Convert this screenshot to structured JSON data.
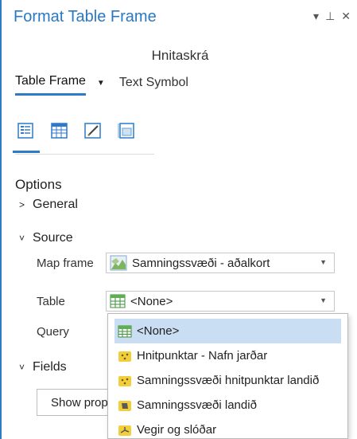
{
  "header": {
    "title": "Format Table Frame",
    "controls": [
      "▾",
      "⊥",
      "✕"
    ]
  },
  "layer_name": "Hnitaskrá",
  "tabs": {
    "table_frame": "Table Frame",
    "text_symbol": "Text Symbol"
  },
  "icon_tabs": [
    "options-icon",
    "table-icon",
    "display-icon",
    "placement-icon"
  ],
  "options": {
    "title": "Options",
    "general": "General",
    "source": "Source",
    "map_frame_label": "Map frame",
    "map_frame_value": "Samningssvæði - aðalkort",
    "table_label": "Table",
    "table_value": "<None>",
    "query_label": "Query",
    "fields": "Fields",
    "show_properties_button": "Show prop"
  },
  "table_dropdown": {
    "items": [
      {
        "label": "<None>",
        "icon": "table-icon",
        "selected": true
      },
      {
        "label": "Hnitpunktar - Nafn jarðar",
        "icon": "point-layer-icon",
        "selected": false
      },
      {
        "label": "Samningssvæði hnitpunktar landið",
        "icon": "point-layer-icon",
        "selected": false
      },
      {
        "label": "Samningssvæði landið",
        "icon": "polygon-layer-icon",
        "selected": false
      },
      {
        "label": "Vegir og slóðar",
        "icon": "line-layer-icon",
        "selected": false
      }
    ]
  },
  "colors": {
    "accent": "#2d7ac7",
    "title": "#2b78c2",
    "selection": "#c9def2"
  }
}
